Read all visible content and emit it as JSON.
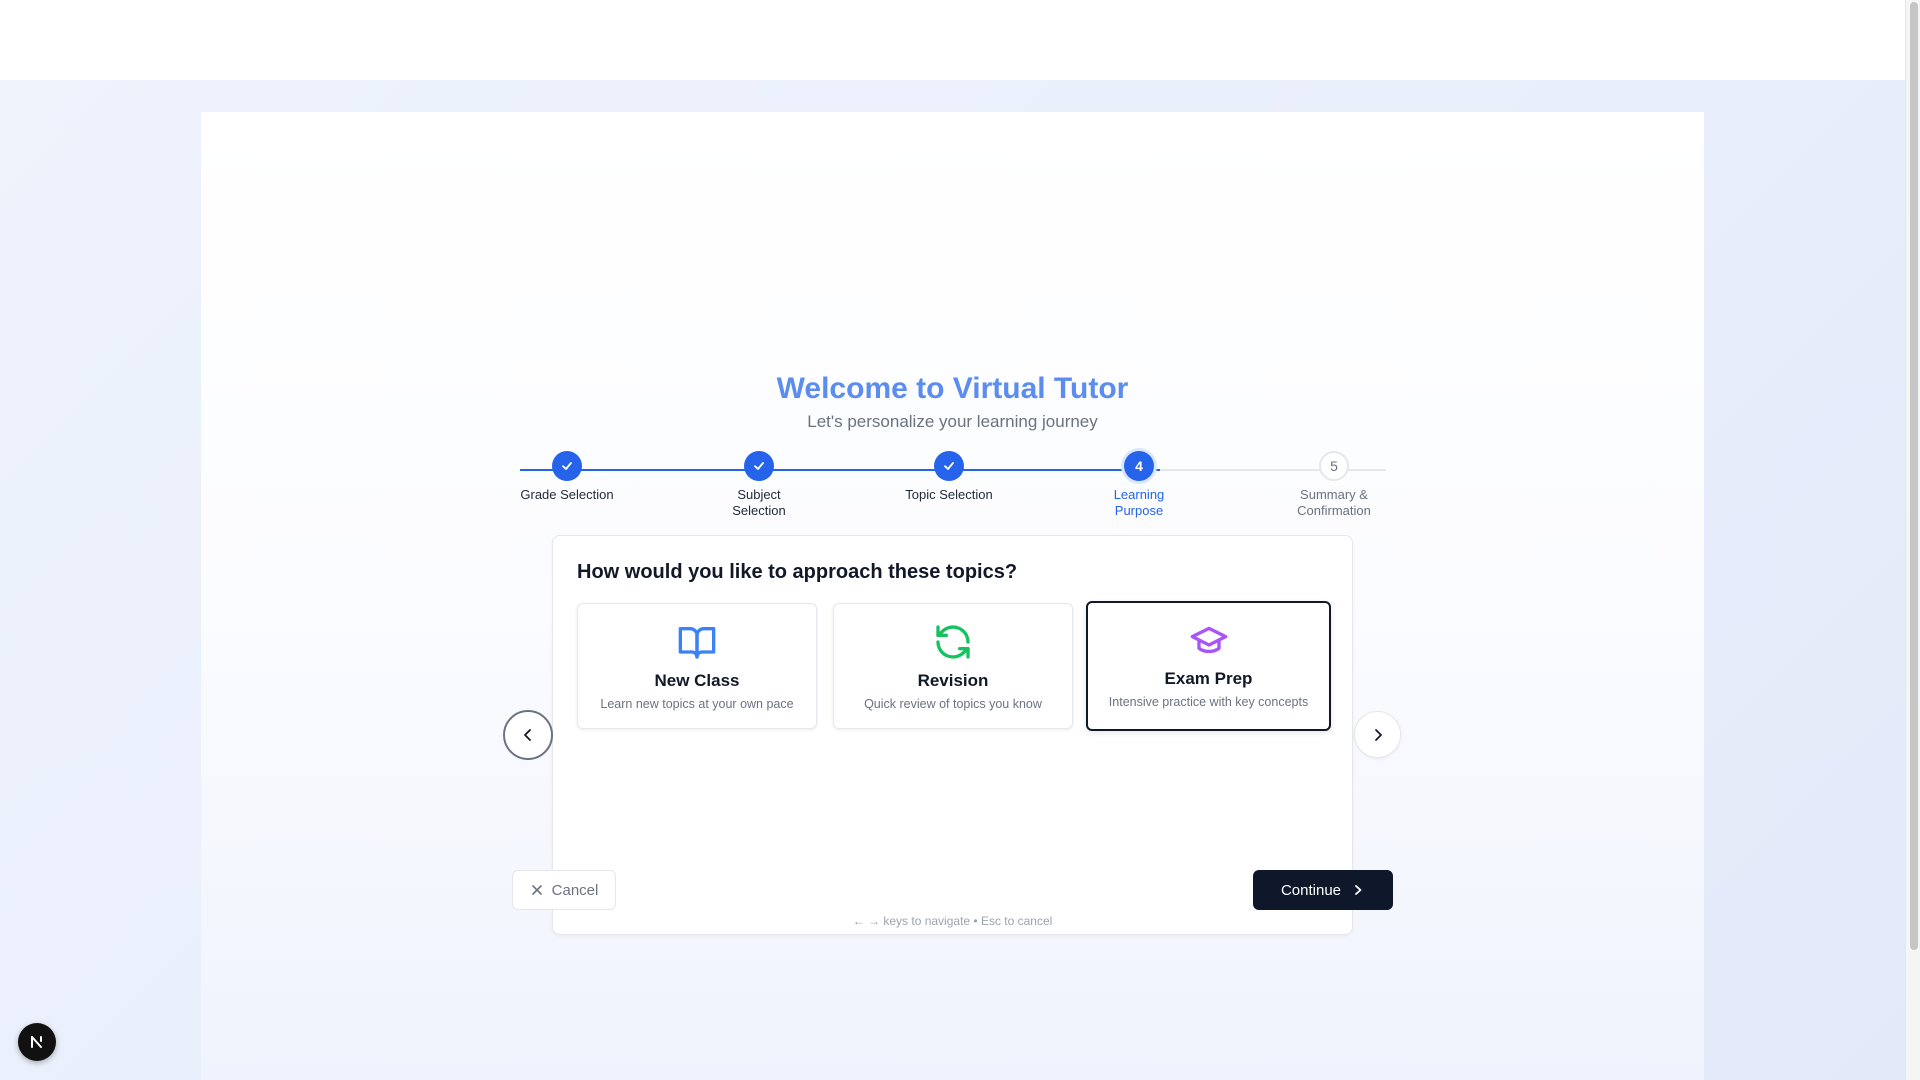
{
  "header": {
    "title": "Welcome to Virtual Tutor",
    "subtitle": "Let's personalize your learning journey"
  },
  "stepper": {
    "steps": [
      {
        "number": "1",
        "label": "Grade Selection",
        "status": "completed"
      },
      {
        "number": "2",
        "label": "Subject Selection",
        "status": "completed"
      },
      {
        "number": "3",
        "label": "Topic Selection",
        "status": "completed"
      },
      {
        "number": "4",
        "label": "Learning Purpose",
        "status": "current"
      },
      {
        "number": "5",
        "label": "Summary & Confirmation",
        "status": "pending"
      }
    ]
  },
  "question": "How would you like to approach these topics?",
  "options": [
    {
      "title": "New Class",
      "description": "Learn new topics at your own pace",
      "icon": "open-book-icon",
      "color": "#3b82f6",
      "selected": false
    },
    {
      "title": "Revision",
      "description": "Quick review of topics you know",
      "icon": "refresh-icon",
      "color": "#16c25f",
      "selected": false
    },
    {
      "title": "Exam Prep",
      "description": "Intensive practice with key concepts",
      "icon": "graduation-cap-icon",
      "color": "#a855f7",
      "selected": true
    }
  ],
  "actions": {
    "cancel_label": "Cancel",
    "continue_label": "Continue"
  },
  "hint": "← → keys to navigate • Esc to cancel",
  "colors": {
    "accent": "#2563eb",
    "title": "#5b8def",
    "primary_button": "#0f172a"
  }
}
